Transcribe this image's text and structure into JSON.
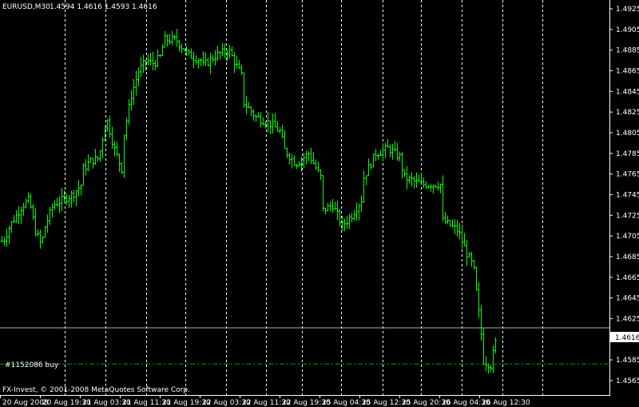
{
  "chart_data": {
    "type": "bar",
    "symbol_header": "EURUSD,M30",
    "ohlc_header": "1.4594 1.4616 1.4593 1.4616",
    "footer": "FX-Invest, © 2001-2008 MetaQuotes Software Corp.",
    "order_label": "#1152086 buy",
    "order_price": 1.4581,
    "current_price": 1.4616,
    "current_price_label": "1.4616",
    "ylim": [
      1.4551,
      1.4925
    ],
    "y_ticks": [
      "1.4925",
      "1.4905",
      "1.4885",
      "1.4865",
      "1.4845",
      "1.4825",
      "1.4805",
      "1.4785",
      "1.4765",
      "1.4745",
      "1.4725",
      "1.4705",
      "1.4685",
      "1.4665",
      "1.4645",
      "1.4625",
      "1.4605",
      "1.4585",
      "1.4565"
    ],
    "x_ticks": [
      "20 Aug 2008",
      "20 Aug 19:30",
      "21 Aug 03:30",
      "21 Aug 11:30",
      "21 Aug 19:30",
      "22 Aug 03:30",
      "22 Aug 11:30",
      "22 Aug 19:30",
      "25 Aug 04:30",
      "25 Aug 12:30",
      "25 Aug 20:30",
      "26 Aug 04:30",
      "26 Aug 12:30"
    ],
    "grid": true,
    "colors": {
      "background": "#000000",
      "bars": "#00ff00",
      "grid": "#ffffff",
      "text": "#ffffff",
      "order_line": "#00a000",
      "price_line": "#b0b0b0"
    },
    "close_path": [
      [
        "20 Aug 2008",
        1.47
      ],
      [
        "20 Aug 2008",
        1.4715
      ],
      [
        "20 Aug 2008",
        1.4725
      ],
      [
        "20 Aug 2008",
        1.4735
      ],
      [
        "20 Aug 2008",
        1.474
      ],
      [
        "20 Aug 2008",
        1.471
      ],
      [
        "20 Aug 2008",
        1.4695
      ],
      [
        "20 Aug 19:30",
        1.471
      ],
      [
        "20 Aug 19:30",
        1.4735
      ],
      [
        "20 Aug 19:30",
        1.474
      ],
      [
        "20 Aug 19:30",
        1.4745
      ],
      [
        "20 Aug 19:30",
        1.4755
      ],
      [
        "21 Aug 03:30",
        1.477
      ],
      [
        "21 Aug 03:30",
        1.4778
      ],
      [
        "21 Aug 03:30",
        1.478
      ],
      [
        "21 Aug 03:30",
        1.482
      ],
      [
        "21 Aug 03:30",
        1.479
      ],
      [
        "21 Aug 03:30",
        1.477
      ],
      [
        "21 Aug 11:30",
        1.48
      ],
      [
        "21 Aug 11:30",
        1.484
      ],
      [
        "21 Aug 11:30",
        1.4865
      ],
      [
        "21 Aug 11:30",
        1.4875
      ],
      [
        "21 Aug 11:30",
        1.4872
      ],
      [
        "21 Aug 11:30",
        1.488
      ],
      [
        "21 Aug 19:30",
        1.4895
      ],
      [
        "21 Aug 19:30",
        1.4895
      ],
      [
        "21 Aug 19:30",
        1.488
      ],
      [
        "21 Aug 19:30",
        1.4875
      ],
      [
        "22 Aug 03:30",
        1.487
      ],
      [
        "22 Aug 03:30",
        1.488
      ],
      [
        "22 Aug 03:30",
        1.4885
      ],
      [
        "22 Aug 03:30",
        1.486
      ],
      [
        "22 Aug 11:30",
        1.4835
      ],
      [
        "22 Aug 11:30",
        1.482
      ],
      [
        "22 Aug 11:30",
        1.4815
      ],
      [
        "22 Aug 11:30",
        1.4805
      ],
      [
        "22 Aug 19:30",
        1.479
      ],
      [
        "22 Aug 19:30",
        1.4775
      ],
      [
        "22 Aug 19:30",
        1.4785
      ],
      [
        "22 Aug 19:30",
        1.476
      ],
      [
        "25 Aug 04:30",
        1.473
      ],
      [
        "25 Aug 04:30",
        1.4735
      ],
      [
        "25 Aug 04:30",
        1.4715
      ],
      [
        "25 Aug 04:30",
        1.4725
      ],
      [
        "25 Aug 04:30",
        1.474
      ],
      [
        "25 Aug 12:30",
        1.476
      ],
      [
        "25 Aug 12:30",
        1.4785
      ],
      [
        "25 Aug 12:30",
        1.479
      ],
      [
        "25 Aug 12:30",
        1.478
      ],
      [
        "25 Aug 20:30",
        1.4762
      ],
      [
        "25 Aug 20:30",
        1.4755
      ],
      [
        "25 Aug 20:30",
        1.4755
      ],
      [
        "26 Aug 04:30",
        1.472
      ],
      [
        "26 Aug 04:30",
        1.4715
      ],
      [
        "26 Aug 04:30",
        1.471
      ],
      [
        "26 Aug 04:30",
        1.469
      ],
      [
        "26 Aug 04:30",
        1.4675
      ],
      [
        "26 Aug 04:30",
        1.461
      ],
      [
        "26 Aug 12:30",
        1.4585
      ],
      [
        "26 Aug 12:30",
        1.458
      ],
      [
        "26 Aug 12:30",
        1.4616
      ]
    ]
  }
}
